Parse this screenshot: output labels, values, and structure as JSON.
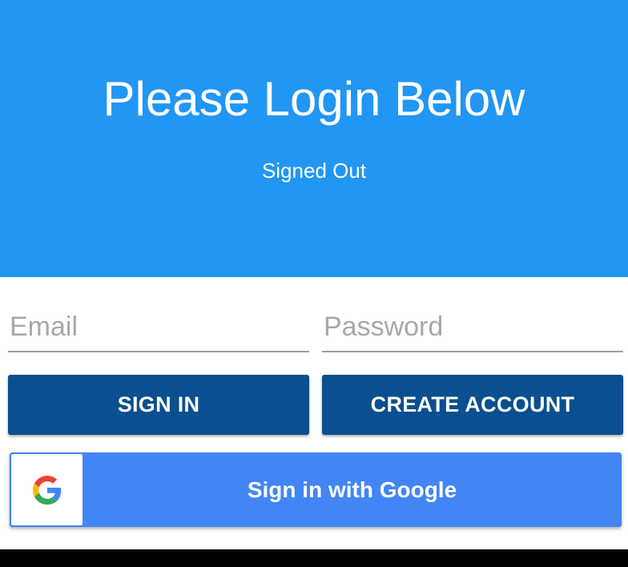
{
  "header": {
    "title": "Please Login Below",
    "status": "Signed Out",
    "background_color": "#2196f3"
  },
  "form": {
    "email_placeholder": "Email",
    "email_value": "",
    "password_placeholder": "Password",
    "password_value": ""
  },
  "actions": {
    "sign_in_label": "SIGN IN",
    "create_account_label": "CREATE ACCOUNT",
    "button_color": "#0a4f8f"
  },
  "google": {
    "label": "Sign in with Google",
    "icon": "google-g-icon",
    "button_color": "#4285f4"
  }
}
